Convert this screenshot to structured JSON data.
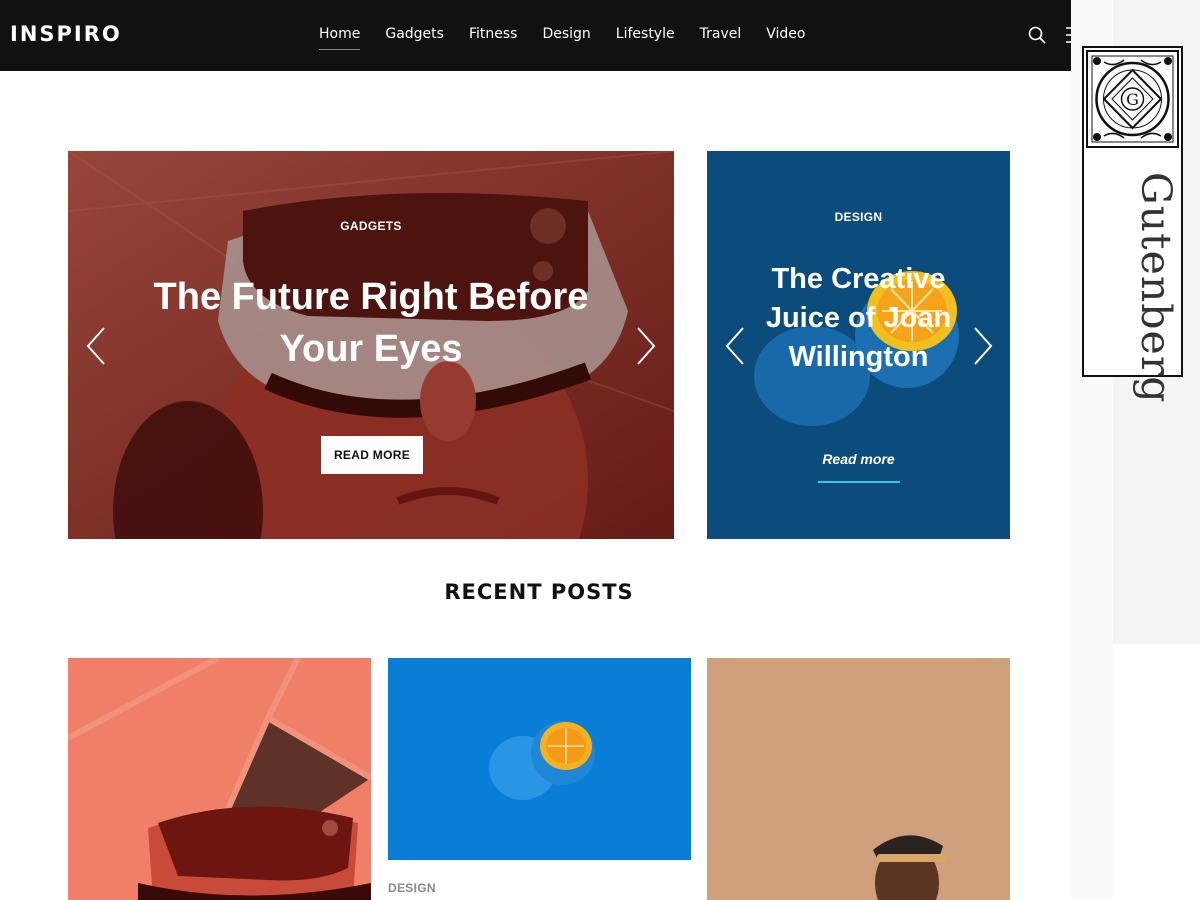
{
  "header": {
    "logo": "INSPIRO",
    "nav": [
      "Home",
      "Gadgets",
      "Fitness",
      "Design",
      "Lifestyle",
      "Travel",
      "Video"
    ],
    "active_nav": "Home"
  },
  "side_panel": {
    "brand": "Gutenberg"
  },
  "hero": {
    "main": {
      "category": "GADGETS",
      "title": "The Future Right Before Your Eyes",
      "button": "READ MORE"
    },
    "side": {
      "category": "DESIGN",
      "title": "The Creative Juice of Joan Willington",
      "link": "Read more"
    }
  },
  "recent": {
    "title": "RECENT POSTS",
    "posts": [
      {
        "category": ""
      },
      {
        "category": "DESIGN"
      },
      {
        "category": ""
      }
    ]
  },
  "colors": {
    "header_bg": "#111111",
    "accent_underline": "#38c6d9",
    "hero_main_tint": "#8a3a2e",
    "hero_side_bg": "#0b4c7c"
  },
  "icons": [
    "search-icon",
    "menu-icon",
    "chevron-left-icon",
    "chevron-right-icon",
    "gutenberg-emblem-icon"
  ]
}
